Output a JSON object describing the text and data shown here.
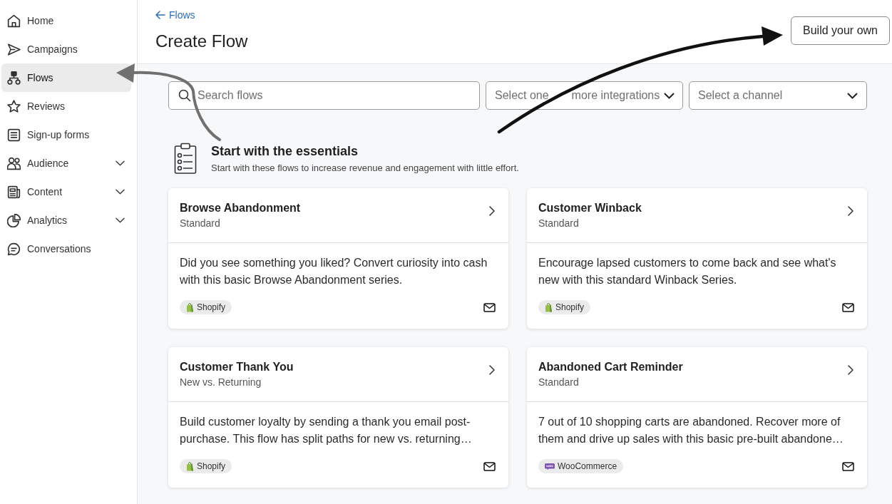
{
  "sidebar": {
    "items": [
      {
        "label": "Home",
        "kind": "link",
        "selected": false
      },
      {
        "label": "Campaigns",
        "kind": "link",
        "selected": false
      },
      {
        "label": "Flows",
        "kind": "link",
        "selected": true
      },
      {
        "label": "Reviews",
        "kind": "link",
        "selected": false
      },
      {
        "label": "Sign-up forms",
        "kind": "link",
        "selected": false
      },
      {
        "label": "Audience",
        "kind": "group",
        "selected": false,
        "expanded": false
      },
      {
        "label": "Content",
        "kind": "group",
        "selected": false,
        "expanded": false
      },
      {
        "label": "Analytics",
        "kind": "group",
        "selected": false,
        "expanded": false
      },
      {
        "label": "Conversations",
        "kind": "link",
        "selected": false
      }
    ]
  },
  "header": {
    "back_link": "Flows",
    "title": "Create Flow",
    "action_button": "Build your own"
  },
  "filters": {
    "search": {
      "placeholder": "Search flows"
    },
    "dropdowns": [
      {
        "placeholder": [
          "Select one",
          "more integrations"
        ]
      },
      {
        "placeholder": [
          "Select a channel"
        ]
      }
    ]
  },
  "section": {
    "title": "Start with the essentials",
    "subtitle": "Start with these flows to increase revenue and engagement with little effort."
  },
  "cards": [
    {
      "title": "Browse Abandonment",
      "subtitle": "Standard",
      "description": "Did you see something you liked? Convert curiosity into cash with this basic Browse Abandonment series.",
      "integration": {
        "kind": "shopify",
        "label": "Shopify"
      }
    },
    {
      "title": "Customer Winback",
      "subtitle": "Standard",
      "description": "Encourage lapsed customers to come back and see what's new with this standard Winback Series.",
      "integration": {
        "kind": "shopify",
        "label": "Shopify"
      }
    },
    {
      "title": "Customer Thank You",
      "subtitle": "New vs. Returning",
      "description": "Build customer loyalty by sending a thank you email post-purchase. This flow has split paths for new vs. returning…",
      "integration": {
        "kind": "shopify",
        "label": "Shopify"
      }
    },
    {
      "title": "Abandoned Cart Reminder",
      "subtitle": "Standard",
      "description": "7 out of 10 shopping carts are abandoned. Recover more of them and drive up sales with this basic pre-built abandone…",
      "integration": {
        "kind": "woocommerce",
        "label": "WooCommerce"
      }
    }
  ]
}
